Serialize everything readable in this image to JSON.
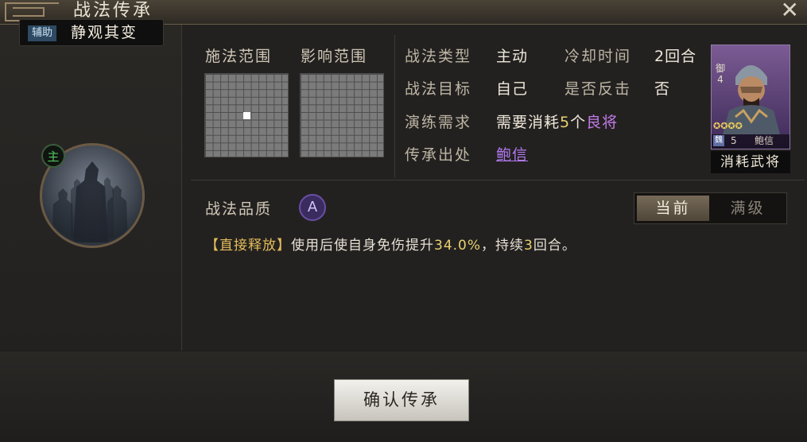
{
  "window": {
    "title": "战法传承",
    "close_label": "✕"
  },
  "skill": {
    "kind": "辅助",
    "name": "静观其变",
    "main_badge": "主"
  },
  "ranges": {
    "cast_label": "施法范围",
    "effect_label": "影响范围"
  },
  "info": {
    "type_label": "战法类型",
    "type_value": "主动",
    "cooldown_label": "冷却时间",
    "cooldown_value": "2回合",
    "target_label": "战法目标",
    "target_value": "自己",
    "counter_label": "是否反击",
    "counter_value": "否",
    "req_label": "演练需求",
    "req_prefix": "需要消耗",
    "req_count": "5",
    "req_unit": "个",
    "req_item": "良将",
    "origin_label": "传承出处",
    "origin_value": "鲍信"
  },
  "general_card": {
    "rank": "御4",
    "stars": "✪✪✪✪",
    "faction": "魏",
    "level": "5",
    "name": "鲍信",
    "caption": "消耗武将"
  },
  "quality": {
    "label": "战法品质",
    "grade": "A"
  },
  "tabs": {
    "current": "当前",
    "max": "满级"
  },
  "description": {
    "tag": "【直接释放】",
    "text_before": "使用后使自身免伤提升",
    "value": "34.0%",
    "text_mid": "，持续",
    "turns": "3",
    "text_after": "回合。"
  },
  "confirm_label": "确认传承",
  "colors": {
    "accent_purple": "#b279f0",
    "number_yellow": "#e7d170",
    "tag_gold": "#e4bd5a"
  }
}
